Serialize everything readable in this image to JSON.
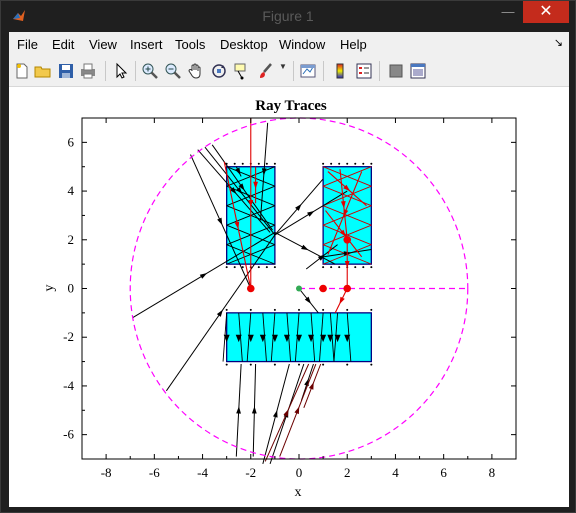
{
  "window": {
    "title": "Figure 1",
    "close_glyph": "✕",
    "min_glyph": "—",
    "max_glyph": "☐"
  },
  "menubar": {
    "items": [
      "File",
      "Edit",
      "View",
      "Insert",
      "Tools",
      "Desktop",
      "Window",
      "Help"
    ],
    "dock_arrow": "↘"
  },
  "toolbar": {
    "icons": [
      "new-figure-icon",
      "open-file-icon",
      "save-icon",
      "print-icon",
      "pointer-icon",
      "zoom-in-icon",
      "zoom-out-icon",
      "pan-icon",
      "rotate-3d-icon",
      "data-cursor-icon",
      "brush-icon",
      "link-plot-icon",
      "colorbar-icon",
      "legend-icon",
      "hide-plot-tools-icon",
      "show-plot-tools-icon"
    ]
  },
  "chart_data": {
    "type": "scatter",
    "title": "Ray Traces",
    "xlabel": "x",
    "ylabel": "y",
    "xlim": [
      -9,
      9
    ],
    "ylim": [
      -7,
      7
    ],
    "xticks": [
      -8,
      -6,
      -4,
      -2,
      0,
      2,
      4,
      6,
      8
    ],
    "yticks": [
      -6,
      -4,
      -2,
      0,
      2,
      4,
      6
    ],
    "grid": false,
    "boundary_circle": {
      "center": [
        0,
        0
      ],
      "radius": 7,
      "color": "#ff00ff",
      "style": "dashed"
    },
    "axis_line": {
      "x": [
        0,
        7
      ],
      "y": [
        0,
        0
      ],
      "color": "#ff00ff",
      "style": "dashed"
    },
    "rectangles": [
      {
        "x": [
          -3,
          -1
        ],
        "y": [
          1,
          5
        ],
        "fill": "#00ffff",
        "edge": "#000080"
      },
      {
        "x": [
          1,
          3
        ],
        "y": [
          1,
          5
        ],
        "fill": "#00ffff",
        "edge": "#000080"
      },
      {
        "x": [
          -3,
          3
        ],
        "y": [
          -3,
          -1
        ],
        "fill": "#00ffff",
        "edge": "#000080"
      }
    ],
    "red_points": [
      [
        -2,
        0
      ],
      [
        1,
        0
      ],
      [
        2,
        0
      ],
      [
        2,
        2
      ]
    ],
    "green_point": [
      0,
      0
    ],
    "black_rays": [
      [
        [
          -4.5,
          5.5
        ],
        [
          -2,
          0
        ]
      ],
      [
        [
          -4.2,
          5.7
        ],
        [
          -1.2,
          2.3
        ]
      ],
      [
        [
          -3.9,
          5.8
        ],
        [
          -1,
          2.2
        ]
      ],
      [
        [
          -3.6,
          5.9
        ],
        [
          -1.1,
          2.4
        ]
      ],
      [
        [
          -6.9,
          -1.2
        ],
        [
          -1,
          2.3
        ]
      ],
      [
        [
          -5.5,
          -4.2
        ],
        [
          -1,
          2.2
        ]
      ],
      [
        [
          -1,
          2.2
        ],
        [
          1,
          4.5
        ]
      ],
      [
        [
          -1,
          2.2
        ],
        [
          2,
          4
        ]
      ],
      [
        [
          -1,
          2.3
        ],
        [
          1.5,
          1
        ]
      ],
      [
        [
          -2.6,
          5
        ],
        [
          -2.4,
          4.6
        ]
      ],
      [
        [
          -1.9,
          -6.9
        ],
        [
          -1.8,
          -3.1
        ]
      ],
      [
        [
          -2.6,
          -6.9
        ],
        [
          -2.4,
          -3.1
        ]
      ],
      [
        [
          -1.5,
          -7.2
        ],
        [
          -0.4,
          -3.1
        ]
      ],
      [
        [
          -1.2,
          -7.2
        ],
        [
          0.2,
          -3.1
        ]
      ],
      [
        [
          -1.3,
          6.8
        ],
        [
          -1.6,
          2.8
        ]
      ],
      [
        [
          0,
          0
        ],
        [
          0.8,
          -1
        ]
      ],
      [
        [
          0.3,
          0.8
        ],
        [
          1.6,
          1.8
        ]
      ],
      [
        [
          0.1,
          -4.6
        ],
        [
          0.6,
          -3.1
        ]
      ],
      [
        [
          1,
          1.3
        ],
        [
          3,
          1.6
        ]
      ]
    ],
    "dark_red_rays": [
      [
        [
          -1.4,
          -7.1
        ],
        [
          0.4,
          -3.1
        ]
      ],
      [
        [
          -0.8,
          -6.9
        ],
        [
          0.7,
          -3.1
        ]
      ],
      [
        [
          0.2,
          -4.9
        ],
        [
          0.9,
          -3.1
        ]
      ]
    ],
    "red_rays": [
      [
        [
          -3.1,
          5.2
        ],
        [
          -2,
          0
        ]
      ],
      [
        [
          -2,
          7
        ],
        [
          -2,
          0
        ]
      ],
      [
        [
          -1.8,
          5
        ],
        [
          -1.8,
          3.5
        ]
      ],
      [
        [
          1.2,
          4.8
        ],
        [
          2.8,
          3.4
        ]
      ],
      [
        [
          1.1,
          3.2
        ],
        [
          2.6,
          1.3
        ]
      ],
      [
        [
          1.7,
          4.9
        ],
        [
          2,
          2
        ]
      ],
      [
        [
          2.6,
          4.8
        ],
        [
          1.2,
          1.4
        ]
      ],
      [
        [
          2,
          2
        ],
        [
          2,
          0
        ]
      ],
      [
        [
          2,
          0
        ],
        [
          1.5,
          -1
        ]
      ]
    ],
    "diagonal_crosses": [
      {
        "x": [
          -3,
          -1
        ],
        "y": [
          1,
          5
        ],
        "color": "#000000"
      },
      {
        "x": [
          1,
          3
        ],
        "y": [
          1,
          5
        ],
        "color": "#cc0000"
      }
    ],
    "vertical_rays_x": [
      -3,
      -2.5,
      -2,
      -1.5,
      -1,
      -0.5,
      0,
      0.5,
      1,
      1.3,
      1.6,
      2
    ]
  }
}
